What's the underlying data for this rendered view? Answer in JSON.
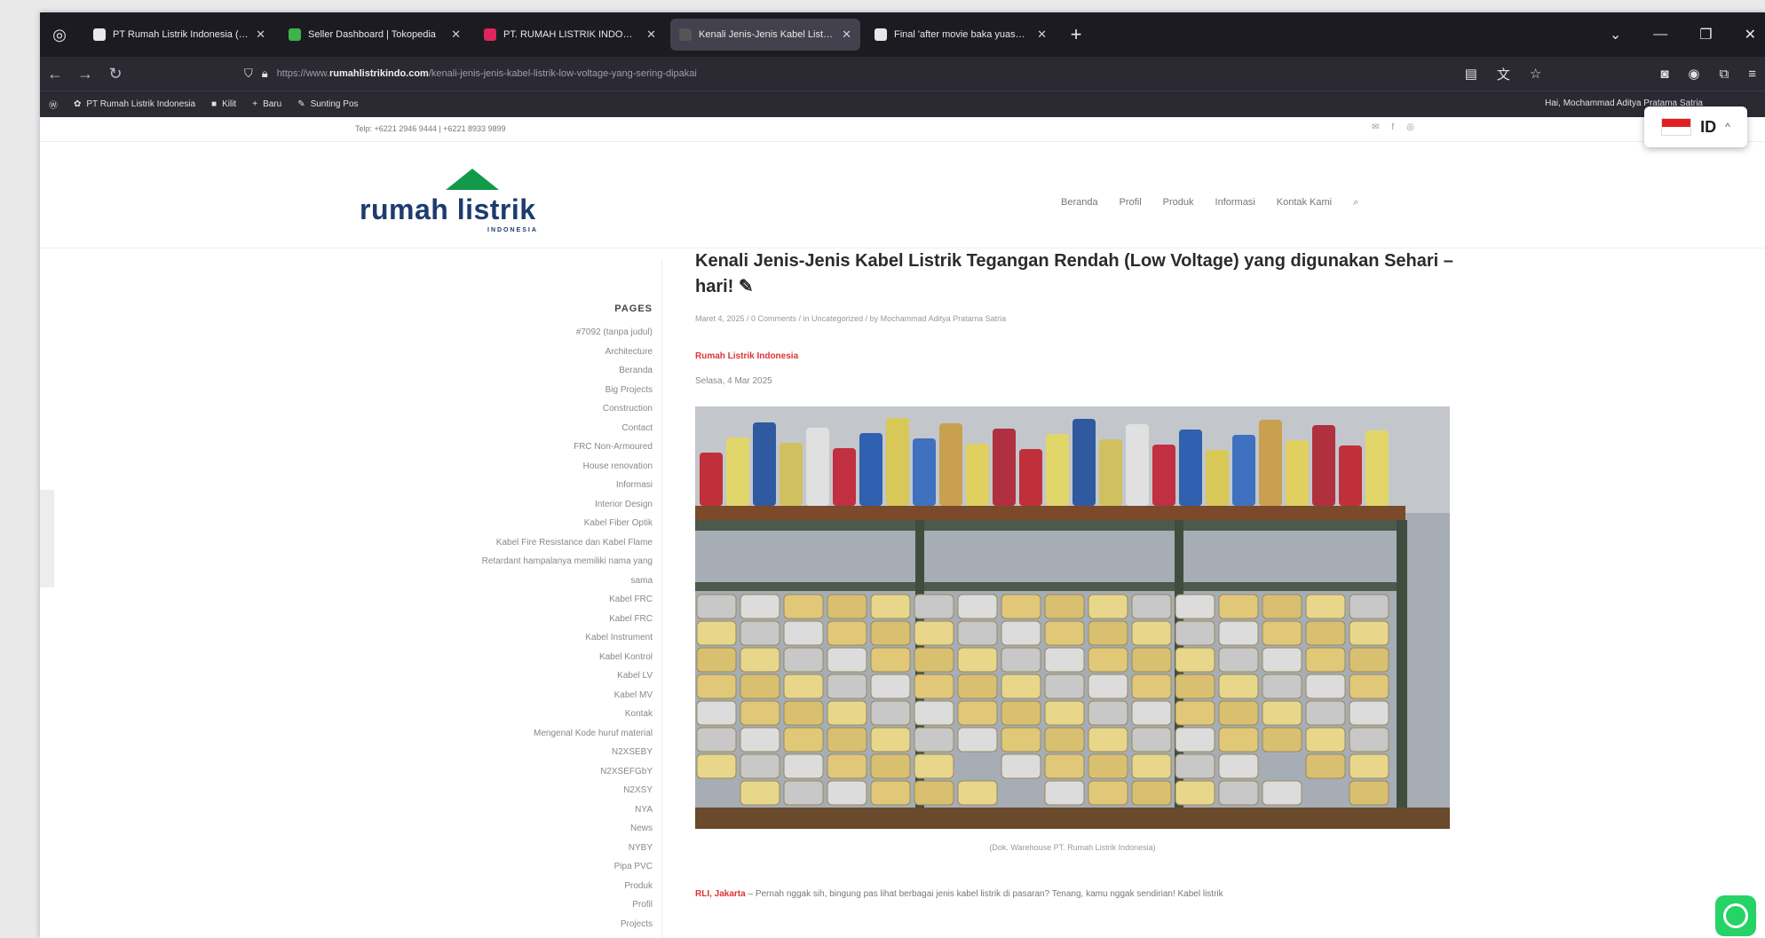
{
  "browser": {
    "tabs": [
      {
        "title": "PT Rumah Listrik Indonesia (E...",
        "favicon_color": "#e8e8e8",
        "active": false
      },
      {
        "title": "Seller Dashboard | Tokopedia",
        "favicon_color": "#3bb44a",
        "active": false
      },
      {
        "title": "PT. RUMAH LISTRIK INDONESI...",
        "favicon_color": "#e0245e",
        "active": false
      },
      {
        "title": "Kenali Jenis-Jenis Kabel Listrik T...",
        "favicon_color": "#555555",
        "active": true
      },
      {
        "title": "Final 'after movie baka yuasa' t...",
        "favicon_color": "#e8e8e8",
        "active": false
      }
    ],
    "url_prefix": "https://www.",
    "url_domain": "rumahlistrikindo.com",
    "url_path": "/kenali-jenis-jenis-kabel-listrik-low-voltage-yang-sering-dipakai",
    "bookmarks": [
      {
        "label": "PT Rumah Listrik Indonesia",
        "icon": "✿"
      },
      {
        "label": "Kilit",
        "icon": "■"
      },
      {
        "label": "Baru",
        "icon": "+"
      },
      {
        "label": "Sunting Pos",
        "icon": "✎"
      }
    ],
    "greeting": "Hai, Mochammad Aditya Pratama Satria",
    "language": {
      "code": "ID",
      "caret": "^"
    }
  },
  "site": {
    "phone": "Telp: +6221 2946 9444 | +6221 8933 9899",
    "logo_text": "rumah listrik",
    "logo_sub": "INDONESIA",
    "menu": [
      "Beranda",
      "Profil",
      "Produk",
      "Informasi",
      "Kontak Kami"
    ],
    "sidebar_title": "PAGES",
    "sidebar_items": [
      "#7092 (tanpa judul)",
      "Architecture",
      "Beranda",
      "Big Projects",
      "Construction",
      "Contact",
      "FRC Non-Armoured",
      "House renovation",
      "Informasi",
      "Interior Design",
      "Kabel Fiber Optik",
      "Kabel Fire Resistance dan Kabel Flame",
      "Retardant hampalanya memiliki nama yang",
      "sama",
      "Kabel FRC",
      "Kabel FRC",
      "Kabel Instrument",
      "Kabel Kontrol",
      "Kabel LV",
      "Kabel MV",
      "Kontak",
      "Mengenal Kode huruf material",
      "N2XSEBY",
      "N2XSEFGbY",
      "N2XSY",
      "NYA",
      "News",
      "NYBY",
      "Pipa PVC",
      "Produk",
      "Profil",
      "Projects"
    ]
  },
  "article": {
    "title": "Kenali Jenis-Jenis Kabel Listrik Tegangan Rendah (Low Voltage) yang digunakan Sehari – hari!",
    "meta": "Maret 4, 2025 / 0 Comments / in Uncategorized / by Mochammad Aditya Pratama Satria",
    "category": "Rumah Listrik Indonesia",
    "date": "Selasa, 4 Mar 2025",
    "caption": "(Dok. Warehouse PT. Rumah Listrik Indonesia)",
    "para_lead": "RLI, Jakarta",
    "para_text": " – Pernah nggak sih, bingung pas lihat berbagai jenis kabel listrik di pasaran? Tenang, kamu nggak sendirian! Kabel listrik"
  }
}
